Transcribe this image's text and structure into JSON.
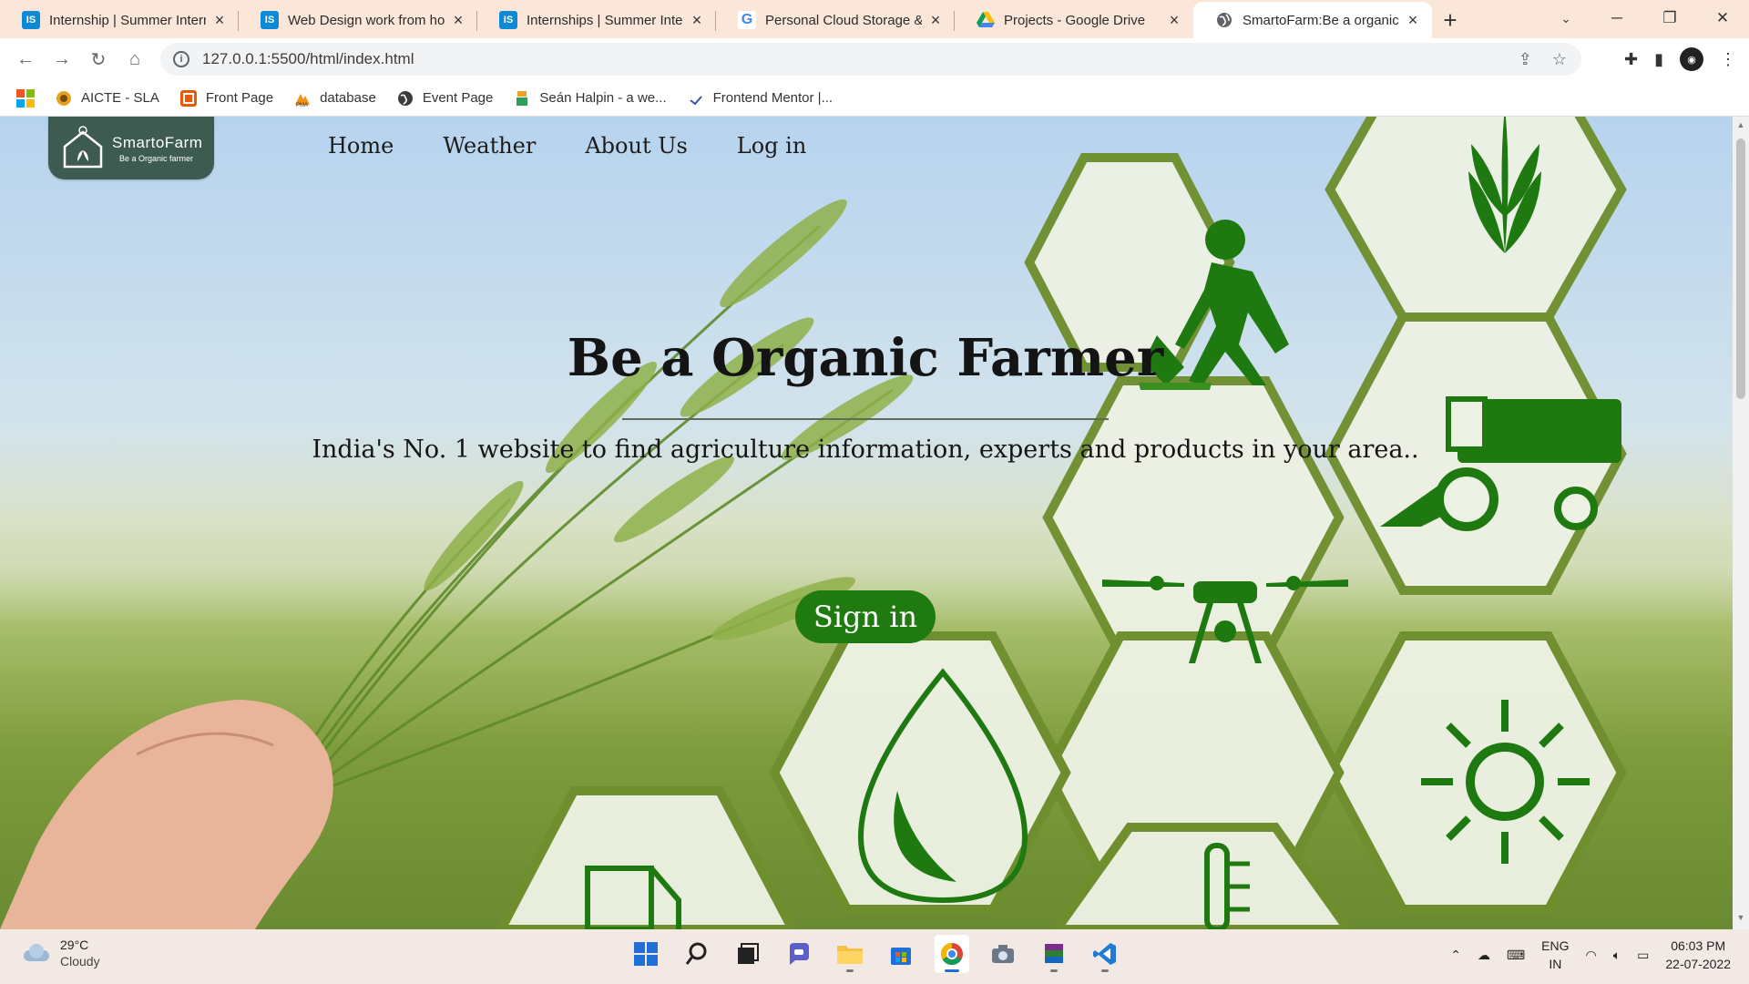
{
  "browser": {
    "tabs": [
      {
        "title": "Internship | Summer Interns",
        "favicon": "is-logo-icon",
        "active": false
      },
      {
        "title": "Web Design work from hom",
        "favicon": "is-logo-icon",
        "active": false
      },
      {
        "title": "Internships | Summer Intern",
        "favicon": "is-logo-icon",
        "active": false
      },
      {
        "title": "Personal Cloud Storage & F",
        "favicon": "google-icon",
        "active": false
      },
      {
        "title": "Projects - Google Drive",
        "favicon": "google-drive-icon",
        "active": false
      },
      {
        "title": "SmartoFarm:Be a organic fa",
        "favicon": "globe-icon",
        "active": true
      }
    ],
    "url": "127.0.0.1:5500/html/index.html",
    "bookmarks": [
      {
        "label": "AICTE - SLA",
        "icon": "aicte-icon"
      },
      {
        "label": "Front Page",
        "icon": "front-page-icon"
      },
      {
        "label": "database",
        "icon": "phpmyadmin-icon"
      },
      {
        "label": "Event Page",
        "icon": "globe-icon"
      },
      {
        "label": "Seán Halpin - a we...",
        "icon": "person-icon"
      },
      {
        "label": "Frontend Mentor |...",
        "icon": "frontend-mentor-icon"
      }
    ]
  },
  "site": {
    "logo": {
      "name": "SmartoFarm",
      "tagline": "Be a Organic farmer"
    },
    "nav": [
      "Home",
      "Weather",
      "About Us",
      "Log in"
    ],
    "hero": {
      "title": "Be a Organic Farmer",
      "subtitle": "India's No. 1 website to find agriculture information, experts and products in your area..",
      "cta": "Sign in"
    },
    "colors": {
      "accent": "#1f7a0f",
      "logo_bg": "#3d5b50",
      "icon_green": "#1e7a10"
    }
  },
  "taskbar": {
    "weather": {
      "temp": "29°C",
      "condition": "Cloudy"
    },
    "language": {
      "line1": "ENG",
      "line2": "IN"
    },
    "clock": {
      "time": "06:03 PM",
      "date": "22-07-2022"
    }
  }
}
